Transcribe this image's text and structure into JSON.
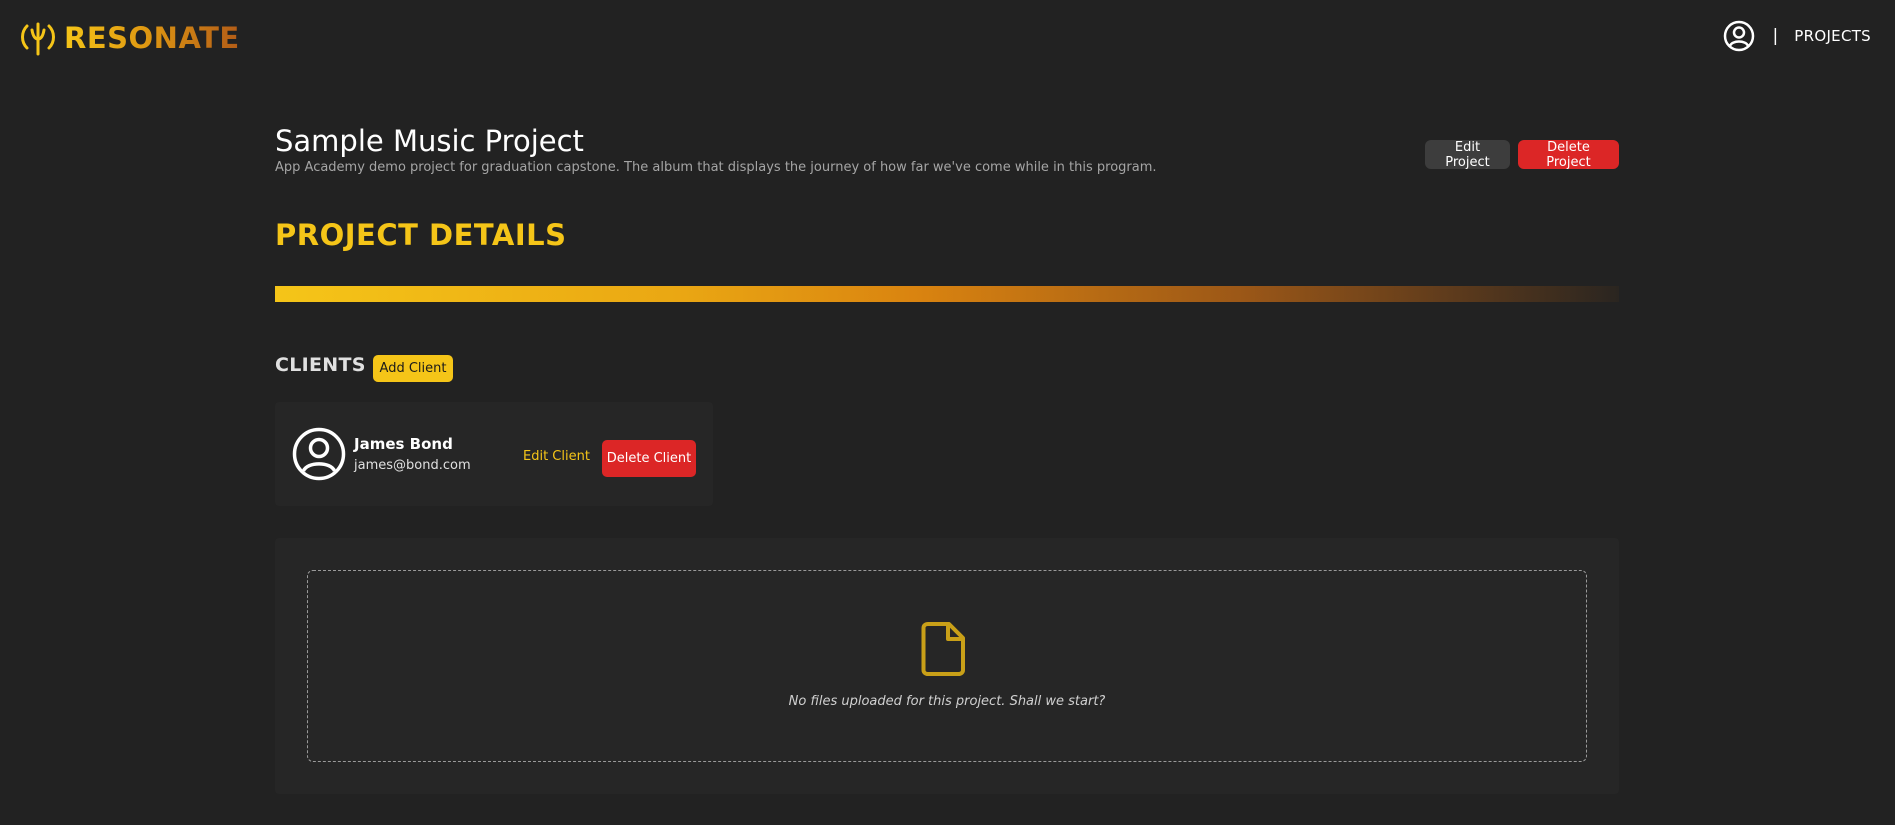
{
  "header": {
    "brand": "RESONATE",
    "logo_icon": "antenna-icon",
    "user_icon": "user-circle-icon",
    "separator": "|",
    "projects_link": "PROJECTS"
  },
  "project": {
    "title": "Sample Music Project",
    "description": "App Academy demo project for graduation capstone. The album that displays the journey of how far we've come while in this program.",
    "edit_label": "Edit Project",
    "delete_label": "Delete Project"
  },
  "details": {
    "heading": "PROJECT DETAILS"
  },
  "clients": {
    "heading": "CLIENTS",
    "add_label": "Add Client",
    "items": [
      {
        "name": "James Bond",
        "email": "james@bond.com",
        "avatar_icon": "user-circle-icon",
        "edit_label": "Edit Client",
        "delete_label": "Delete Client"
      }
    ]
  },
  "files": {
    "icon": "file-icon",
    "empty_message": "No files uploaded for this project. Shall we start?"
  },
  "colors": {
    "background": "#222222",
    "accent": "#f5c518",
    "danger": "#dc2626",
    "panel": "#262626"
  }
}
